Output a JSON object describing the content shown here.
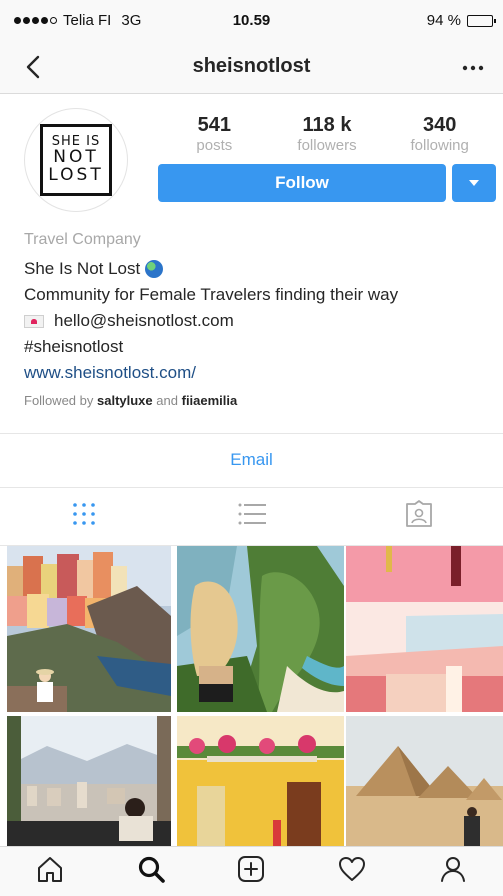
{
  "status_bar": {
    "carrier": "Telia FI",
    "network": "3G",
    "time": "10.59",
    "battery_text": "94 %",
    "battery_level": 0.94
  },
  "nav": {
    "title": "sheisnotlost",
    "back_icon": "chevron-left-icon",
    "more_icon": "more-horizontal-icon"
  },
  "profile": {
    "avatar_logo": [
      "SHE IS",
      "NOT",
      "LOST"
    ],
    "stats": [
      {
        "value": "541",
        "label": "posts"
      },
      {
        "value": "118 k",
        "label": "followers"
      },
      {
        "value": "340",
        "label": "following"
      }
    ],
    "follow_label": "Follow",
    "accent_color": "#3897f0"
  },
  "bio": {
    "category": "Travel Company",
    "name": "She Is Not Lost",
    "description": "Community for Female Travelers finding their way",
    "email": "hello@sheisnotlost.com",
    "hashtag": "#sheisnotlost",
    "website": "www.sheisnotlost.com/",
    "followed_by_prefix": "Followed by",
    "followed_by_user1": "saltyluxe",
    "followed_by_and": "and",
    "followed_by_user2": "fiiaemilia"
  },
  "contact": {
    "email_button": "Email"
  },
  "tabs": [
    {
      "name": "grid-icon",
      "active": true
    },
    {
      "name": "list-icon",
      "active": false
    },
    {
      "name": "tagged-icon",
      "active": false
    }
  ],
  "bottom_nav": [
    {
      "name": "home-icon"
    },
    {
      "name": "search-icon",
      "active": true
    },
    {
      "name": "add-post-icon"
    },
    {
      "name": "activity-heart-icon"
    },
    {
      "name": "profile-icon"
    }
  ]
}
